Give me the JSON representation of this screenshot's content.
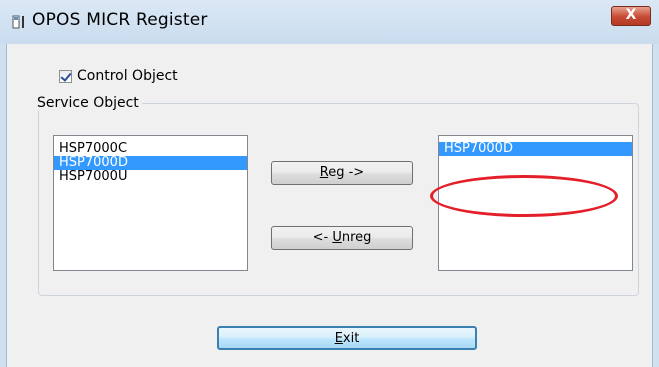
{
  "window": {
    "title": "OPOS MICR Register",
    "close_label": "X",
    "icon": "app-window-icon"
  },
  "control_object": {
    "label": "Control Object",
    "checked": true
  },
  "service_object": {
    "group_label": "Service Object",
    "available_items": [
      "HSP7000C",
      "HSP7000D",
      "HSP7000U"
    ],
    "available_selected": "HSP7000D",
    "registered_items": [
      "HSP7000D"
    ],
    "registered_selected": "HSP7000D"
  },
  "buttons": {
    "reg_prefix": "",
    "reg_accel": "R",
    "reg_rest": "eg ->",
    "unreg_prefix": "<- ",
    "unreg_accel": "U",
    "unreg_rest": "nreg",
    "exit_prefix": "",
    "exit_accel": "E",
    "exit_rest": "xit"
  },
  "colors": {
    "selection": "#3399ff",
    "annotation": "#e3202a",
    "titlebar": "#cfe0f0",
    "close_button": "#c74a33"
  }
}
